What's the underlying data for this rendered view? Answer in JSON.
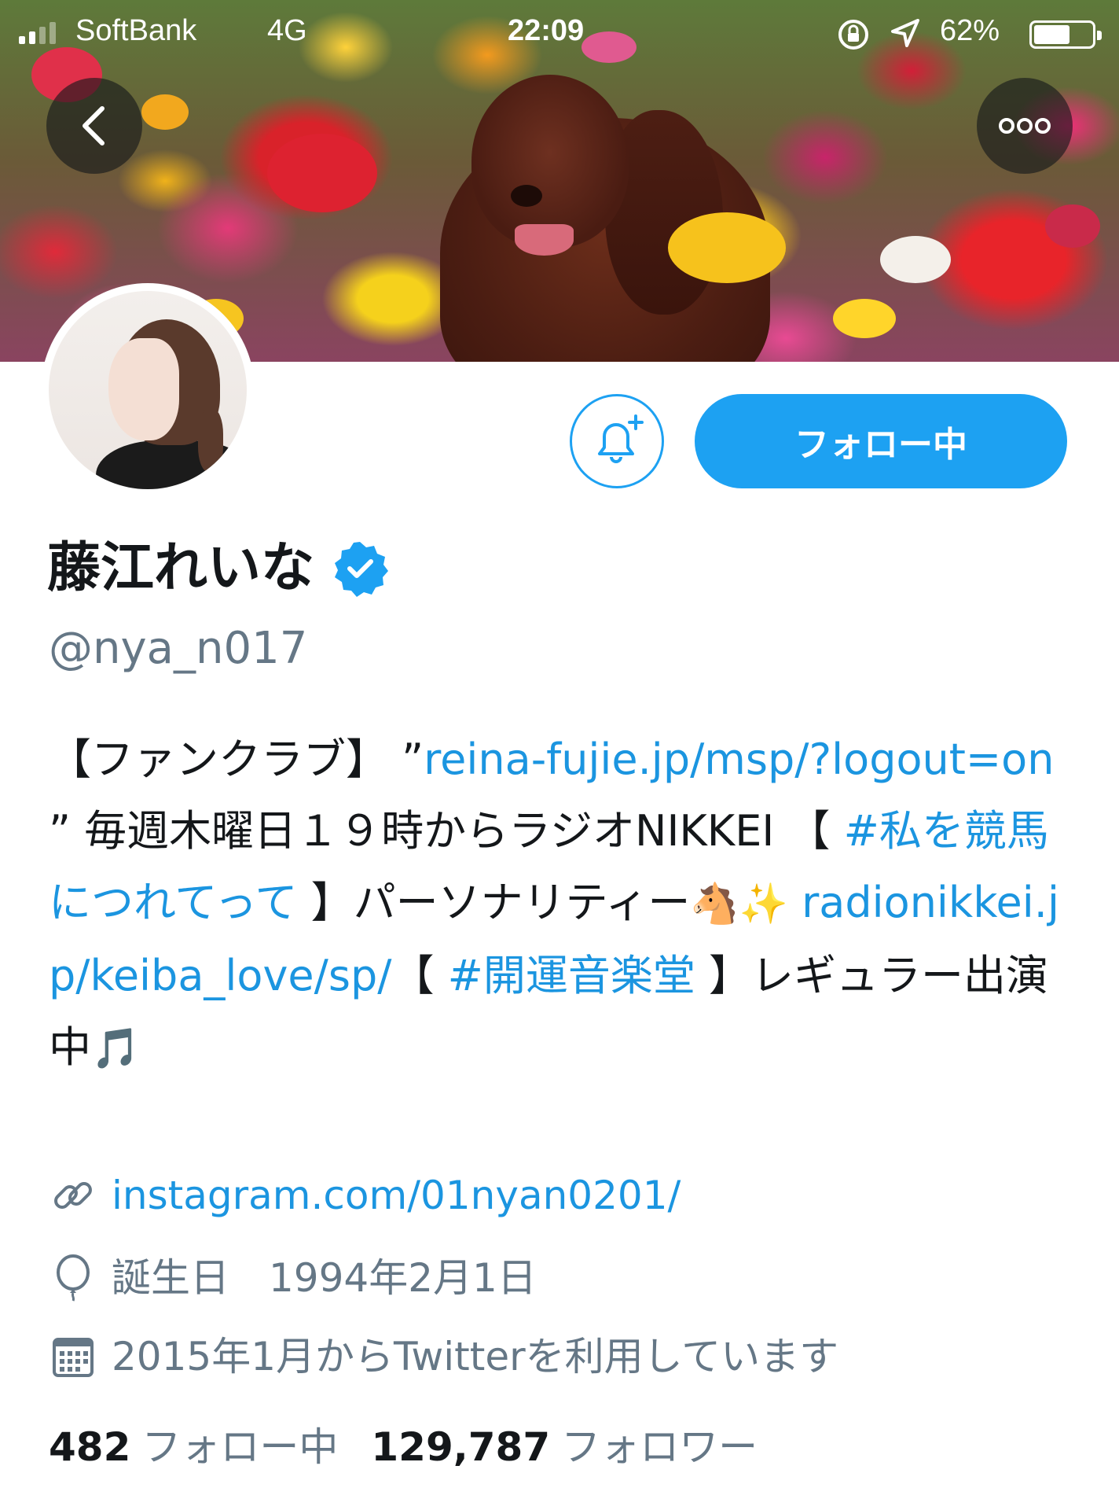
{
  "status_bar": {
    "carrier": "SoftBank",
    "network": "4G",
    "time": "22:09",
    "battery_percent": "62%",
    "battery_level": 0.62,
    "signal_bars": 2
  },
  "header": {
    "back_icon": "chevron-left-icon",
    "more_icon": "ellipsis-icon"
  },
  "actions": {
    "notify_icon": "bell-plus-icon",
    "following_label": "フォロー中"
  },
  "profile": {
    "name": "藤江れいな",
    "verified": true,
    "handle": "@nya_n017",
    "bio": {
      "t1": "【ファンクラブ】 ”",
      "link1": "reina-fujie.jp/msp/?logout=on",
      "t2": " ” 毎週木曜日１９時からラジオNIKKEI 【 ",
      "hashtag1": "#私を競馬につれてって",
      "t3": " 】パーソナリティー",
      "emoji1": "🐴",
      "emoji2": "✨",
      "t4": " ",
      "link2": "radionikkei.jp/keiba_love/sp/",
      "t5": "【 ",
      "hashtag2": "#開運音楽堂",
      "t6": " 】レギュラー出演中",
      "emoji3": "🎵"
    },
    "website": "instagram.com/01nyan0201/",
    "birthday": "誕生日　1994年2月1日",
    "joined": "2015年1月からTwitterを利用しています"
  },
  "stats": {
    "following_count": "482",
    "following_label": "フォロー中",
    "followers_count": "129,787",
    "followers_label": "フォロワー"
  },
  "colors": {
    "accent": "#1da1f2",
    "link": "#1b95e0",
    "secondary_text": "#657786",
    "primary_text": "#14171a"
  }
}
